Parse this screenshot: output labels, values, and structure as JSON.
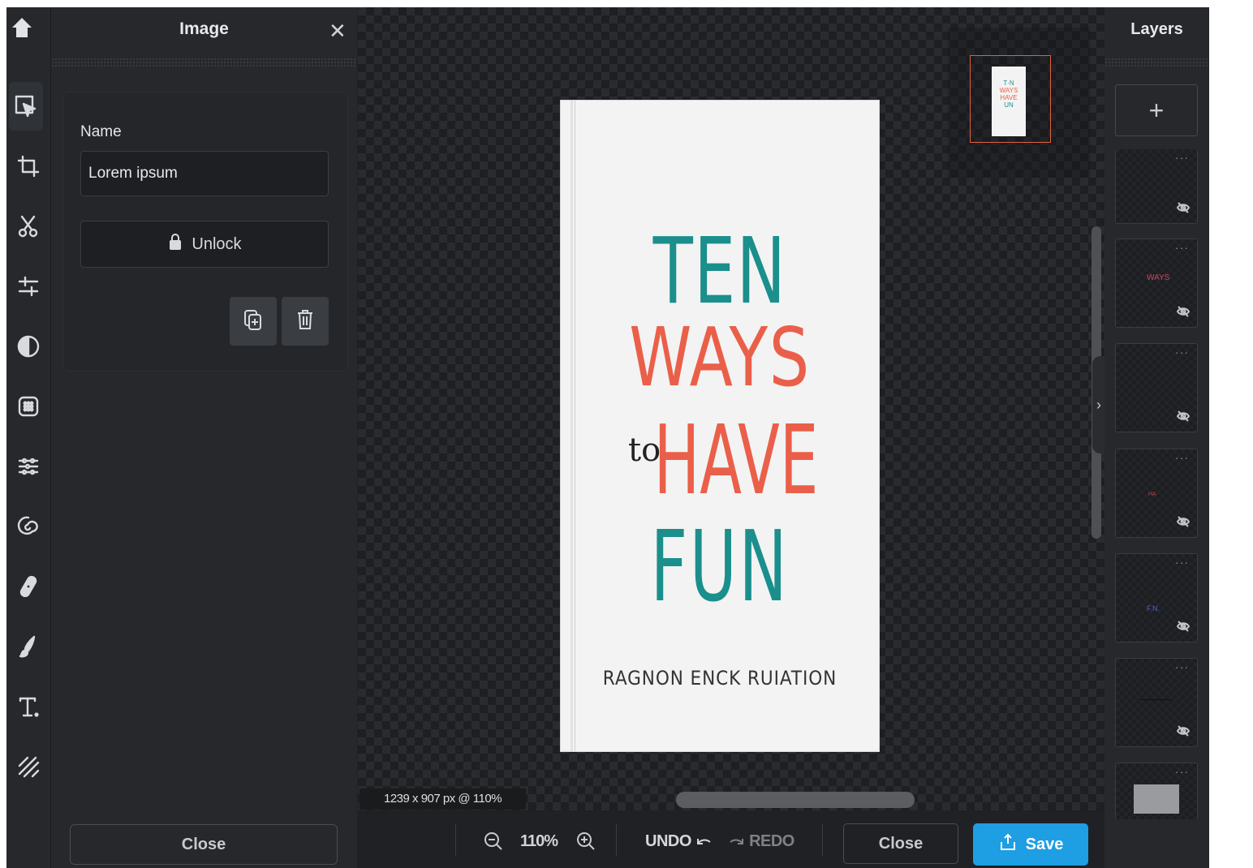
{
  "panel": {
    "title": "Image",
    "name_label": "Name",
    "name_value": "Lorem ipsum",
    "unlock_label": "Unlock",
    "close_label": "Close"
  },
  "canvas": {
    "dimensions": "1239 x 907 px @ 110%",
    "cover": {
      "line1": "TEN",
      "line2": "WAYS",
      "line3_small": "to",
      "line3": "HAVE",
      "line4": "FUN",
      "author": "RAGNON ENCK RUIATION"
    },
    "minimap": {
      "l1": "T·N",
      "l2": "WAYS",
      "l3": "HAVE",
      "l4": "UN"
    }
  },
  "bottombar": {
    "zoom": "110%",
    "undo_label": "UNDO",
    "redo_label": "REDO",
    "close_label": "Close",
    "save_label": "Save"
  },
  "layers": {
    "title": "Layers",
    "add_symbol": "+",
    "items": [
      {
        "thumb": "",
        "color": "#4d63c9"
      },
      {
        "thumb": "WAYS",
        "color": "#c84a5e"
      },
      {
        "thumb": "",
        "color": "#444"
      },
      {
        "thumb": "HA",
        "color": "#c53a4a"
      },
      {
        "thumb": "F.N.",
        "color": "#4d63c9"
      },
      {
        "thumb": "",
        "color": "#222"
      }
    ]
  },
  "colors": {
    "accent": "#1e9ee3",
    "teal": "#1b8f8c",
    "coral": "#ea5f49",
    "minimap_border": "#e0613e"
  },
  "icons": [
    "home-icon",
    "select-icon",
    "crop-icon",
    "cut-icon",
    "adjust-icon",
    "filter-icon",
    "effects-icon",
    "liquify-icon",
    "swirl-icon",
    "healing-icon",
    "brush-icon",
    "text-icon",
    "pattern-icon",
    "lock-icon",
    "duplicate-icon",
    "trash-icon",
    "zoom-out-icon",
    "zoom-in-icon",
    "undo-icon",
    "redo-icon",
    "download-icon",
    "hide-icon"
  ]
}
